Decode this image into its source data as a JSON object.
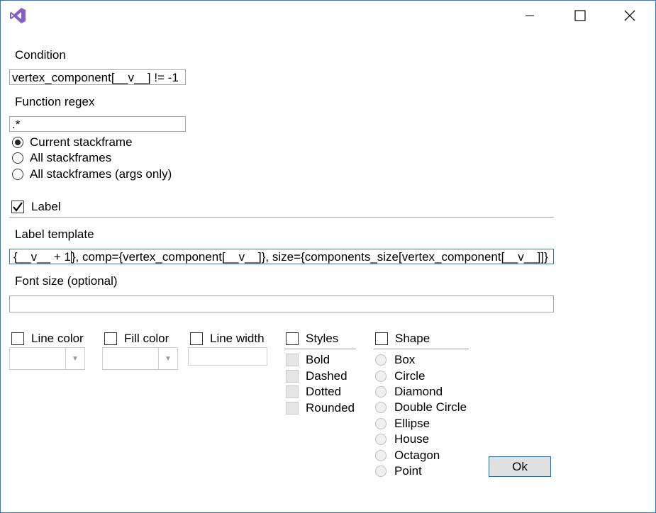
{
  "app": {
    "icon": "visual-studio-icon"
  },
  "titlebar": {
    "minimize_icon": "minimize-icon",
    "maximize_icon": "maximize-icon",
    "close_icon": "close-icon"
  },
  "condition": {
    "label": "Condition",
    "value": "vertex_component[__v__] != -1"
  },
  "function_regex": {
    "label": "Function regex",
    "value": ".*"
  },
  "stack_options": [
    {
      "label": "Current stackframe",
      "selected": true
    },
    {
      "label": "All stackframes",
      "selected": false
    },
    {
      "label": "All stackframes (args only)",
      "selected": false
    }
  ],
  "label_checkbox": {
    "label": "Label",
    "checked": true
  },
  "label_template": {
    "label": "Label template",
    "value_before_caret": "{__v__ + 1",
    "value_after_caret": "}, comp={vertex_component[__v__]}, size={components_size[vertex_component[__v__]]}"
  },
  "font_size": {
    "label": "Font size (optional)",
    "value": ""
  },
  "line_color": {
    "label": "Line color",
    "checked": false,
    "value": ""
  },
  "fill_color": {
    "label": "Fill color",
    "checked": false,
    "value": ""
  },
  "line_width": {
    "label": "Line width",
    "checked": false,
    "value": ""
  },
  "styles": {
    "label": "Styles",
    "checked": false,
    "items": [
      "Bold",
      "Dashed",
      "Dotted",
      "Rounded"
    ]
  },
  "shape": {
    "label": "Shape",
    "checked": false,
    "items": [
      "Box",
      "Circle",
      "Diamond",
      "Double Circle",
      "Ellipse",
      "House",
      "Octagon",
      "Point"
    ]
  },
  "ok_button": {
    "label": "Ok"
  },
  "colors": {
    "accent": "#0078d7",
    "vs_purple": "#865fc5",
    "window_border": "#2b79d8"
  }
}
